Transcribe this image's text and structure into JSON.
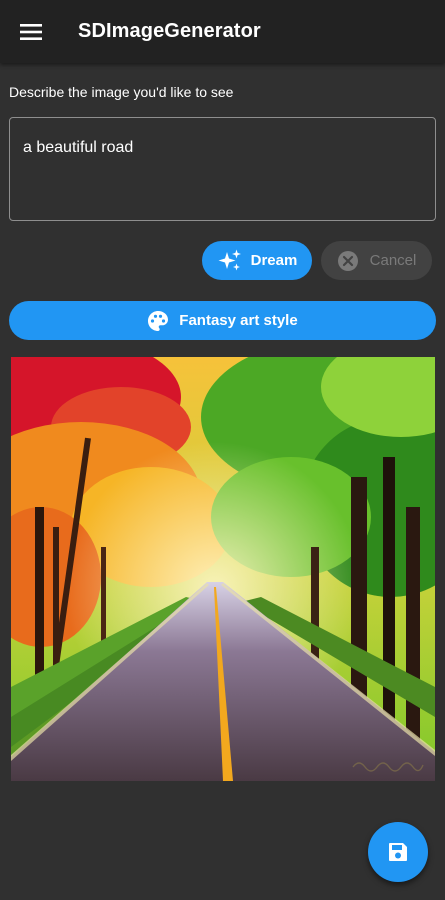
{
  "app_bar": {
    "title": "SDImageGenerator",
    "menu_icon": "menu-icon",
    "background": "#222222"
  },
  "prompt": {
    "label": "Describe the image you'd like to see",
    "value": "a beautiful road"
  },
  "actions": {
    "dream_label": "Dream",
    "dream_icon": "sparkles-icon",
    "cancel_label": "Cancel",
    "cancel_icon": "cancel-icon",
    "cancel_enabled": false
  },
  "style_button": {
    "label": "Fantasy art style",
    "icon": "palette-icon"
  },
  "image": {
    "subject": "road through autumn forest",
    "watermark_icon": "signature"
  },
  "fab": {
    "icon": "save-icon"
  },
  "colors": {
    "accent": "#2196f3",
    "background": "#303030",
    "disabled_button": "#424242",
    "disabled_text": "#7a7a7a"
  }
}
